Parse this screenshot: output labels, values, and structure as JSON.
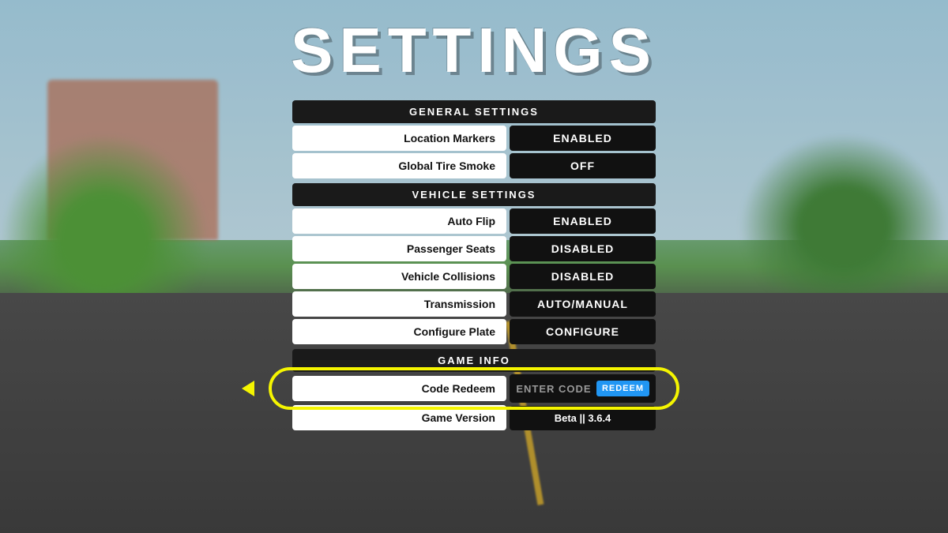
{
  "page": {
    "title": "SETTINGS"
  },
  "sections": {
    "general": {
      "header": "GENERAL SETTINGS",
      "items": [
        {
          "label": "Location Markers",
          "value": "ENABLED",
          "type": "enabled"
        },
        {
          "label": "Global Tire Smoke",
          "value": "OFF",
          "type": "off"
        }
      ]
    },
    "vehicle": {
      "header": "VEHICLE SETTINGS",
      "items": [
        {
          "label": "Auto Flip",
          "value": "ENABLED",
          "type": "enabled"
        },
        {
          "label": "Passenger Seats",
          "value": "DISABLED",
          "type": "disabled"
        },
        {
          "label": "Vehicle Collisions",
          "value": "DISABLED",
          "type": "disabled"
        },
        {
          "label": "Transmission",
          "value": "AUTO/MANUAL",
          "type": "auto"
        },
        {
          "label": "Configure Plate",
          "value": "CONFIGURE",
          "type": "configure"
        }
      ]
    },
    "gameinfo": {
      "header": "GAME INFO",
      "code_redeem": {
        "label": "Code Redeem",
        "placeholder": "ENTER CODE",
        "button": "REDEEM"
      },
      "version": {
        "label": "Game Version",
        "value": "Beta || 3.6.4"
      }
    }
  }
}
